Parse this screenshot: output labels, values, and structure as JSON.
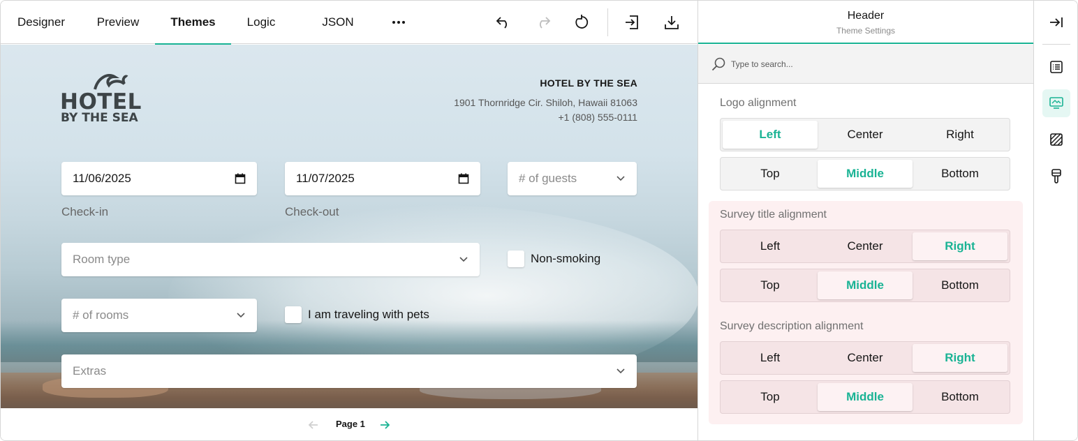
{
  "toolbar": {
    "tabs": [
      {
        "label": "Designer"
      },
      {
        "label": "Preview"
      },
      {
        "label": "Themes"
      },
      {
        "label": "Logic"
      },
      {
        "label": "JSON Editor"
      }
    ],
    "active_tab": "Themes",
    "icons": [
      "more-icon",
      "undo-icon",
      "redo-icon",
      "reset-icon",
      "import-icon",
      "download-icon"
    ]
  },
  "survey": {
    "hotel_name": "HOTEL BY THE SEA",
    "address": "1901 Thornridge Cir. Shiloh, Hawaii 81063",
    "phone": "+1 (808) 555-0111",
    "logo_line1": "HOTEL",
    "logo_line2": "BY THE SEA",
    "checkin_value": "11/06/2025",
    "checkin_label": "Check-in",
    "checkout_value": "11/07/2025",
    "checkout_label": "Check-out",
    "guests_placeholder": "# of guests",
    "room_type_placeholder": "Room type",
    "non_smoking_label": "Non-smoking",
    "rooms_placeholder": "# of rooms",
    "pets_label": "I am traveling with pets",
    "extras_placeholder": "Extras"
  },
  "pager": {
    "label": "Page 1"
  },
  "panel": {
    "title": "Header",
    "subtitle": "Theme Settings",
    "search_placeholder": "Type to search...",
    "logo_alignment": {
      "label": "Logo alignment",
      "horizontal": [
        "Left",
        "Center",
        "Right"
      ],
      "horizontal_selected": "Left",
      "vertical": [
        "Top",
        "Middle",
        "Bottom"
      ],
      "vertical_selected": "Middle"
    },
    "title_alignment": {
      "label": "Survey title alignment",
      "horizontal": [
        "Left",
        "Center",
        "Right"
      ],
      "horizontal_selected": "Right",
      "vertical": [
        "Top",
        "Middle",
        "Bottom"
      ],
      "vertical_selected": "Middle"
    },
    "description_alignment": {
      "label": "Survey description alignment",
      "horizontal": [
        "Left",
        "Center",
        "Right"
      ],
      "horizontal_selected": "Right",
      "vertical": [
        "Top",
        "Middle",
        "Bottom"
      ],
      "vertical_selected": "Middle"
    }
  },
  "rail": {
    "icons": [
      "collapse-panel-icon",
      "general-settings-icon",
      "header-settings-icon",
      "background-icon",
      "appearance-brush-icon"
    ],
    "active": "header-settings-icon"
  },
  "colors": {
    "accent": "#19b394",
    "highlight": "#fdf0f1"
  }
}
